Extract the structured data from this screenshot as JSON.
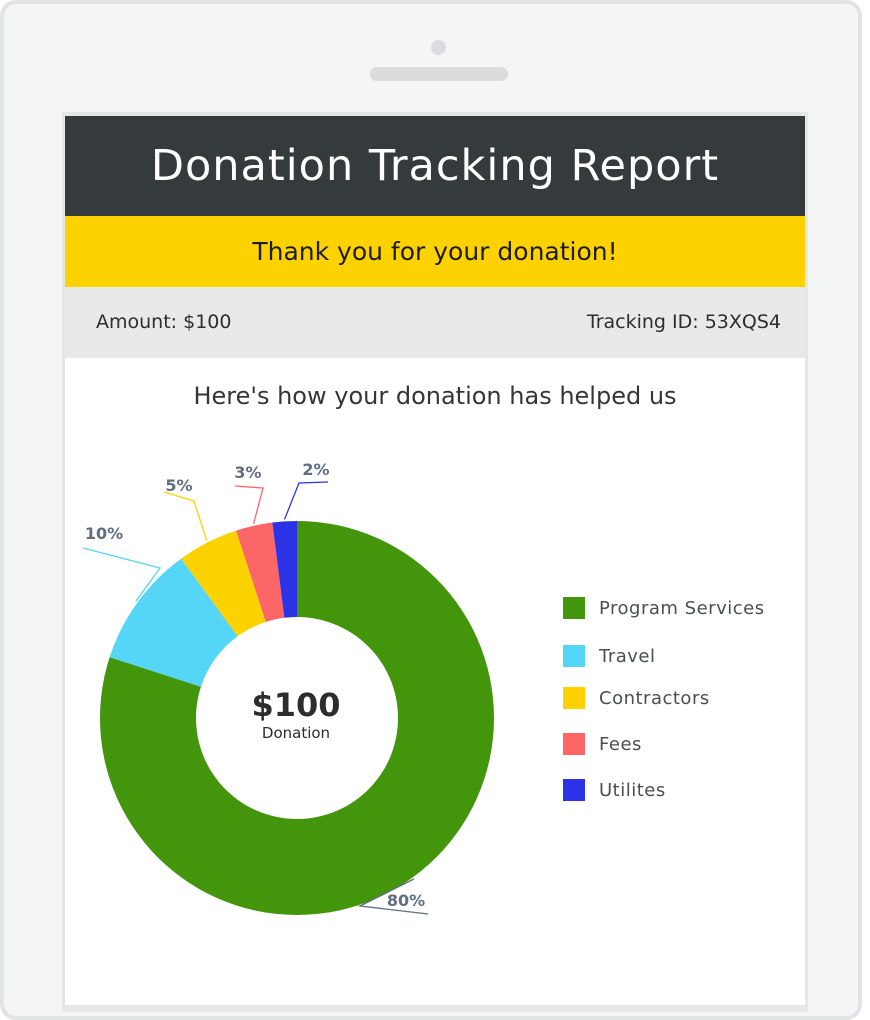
{
  "header": {
    "title": "Donation Tracking Report"
  },
  "banner": {
    "message": "Thank you for your donation!"
  },
  "info": {
    "amount": "Amount: $100",
    "tracking_id": "Tracking ID: 53XQS4"
  },
  "subtitle": "Here's how your donation has helped us",
  "chart_data": {
    "type": "pie",
    "donut": true,
    "center_value": "$100",
    "center_label": "Donation",
    "legend_position": "right",
    "slices": [
      {
        "name": "Program Services",
        "value": 80,
        "label": "80%",
        "color": "#43960b"
      },
      {
        "name": "Travel",
        "value": 10,
        "label": "10%",
        "color": "#55d6f6"
      },
      {
        "name": "Contractors",
        "value": 5,
        "label": "5%",
        "color": "#fdd200"
      },
      {
        "name": "Fees",
        "value": 3,
        "label": "3%",
        "color": "#fd6666"
      },
      {
        "name": "Utilites",
        "value": 2,
        "label": "2%",
        "color": "#2c33e6"
      }
    ]
  }
}
